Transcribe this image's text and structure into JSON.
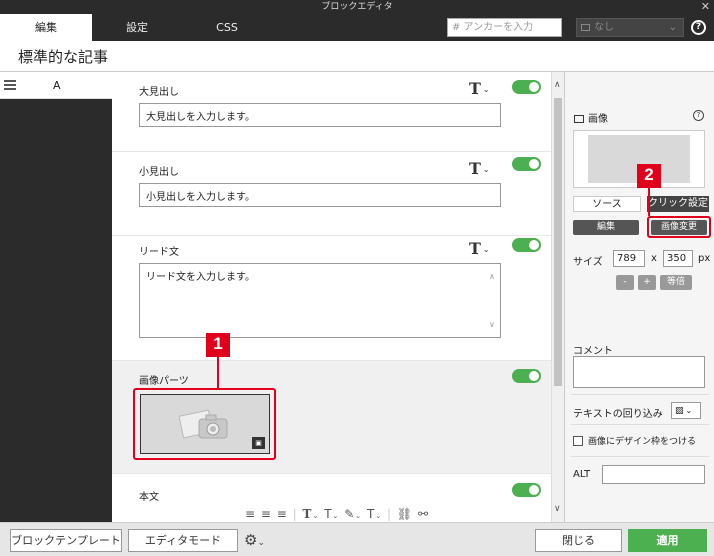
{
  "window": {
    "title": "ブロックエディタ",
    "close": "✕"
  },
  "tabs": [
    {
      "label": "編集",
      "active": true
    },
    {
      "label": "設定",
      "active": false
    },
    {
      "label": "CSS",
      "active": false
    }
  ],
  "anchor": {
    "placeholder": "# アンカーを入力"
  },
  "style_select": {
    "value": "なし",
    "icon": "image-icon"
  },
  "page_title": "標準的な記事",
  "left_column": {
    "letter": "A"
  },
  "blocks": [
    {
      "label": "大見出し",
      "field": "大見出しを入力します。",
      "enabled": true
    },
    {
      "label": "小見出し",
      "field": "小見出しを入力します。",
      "enabled": true
    },
    {
      "label": "リード文",
      "field": "リード文を入力します。",
      "enabled": true
    },
    {
      "label": "画像パーツ",
      "enabled": true
    },
    {
      "label": "本文",
      "enabled": true
    }
  ],
  "callouts": [
    "1",
    "2"
  ],
  "right_panel": {
    "title": "画像",
    "tabs": [
      "ソース",
      "クリック設定"
    ],
    "edit_button": "編集",
    "change_button": "画像変更",
    "size_label": "サイズ",
    "width": "789",
    "x": "x",
    "height": "350",
    "unit": "px",
    "minus": "-",
    "plus": "+",
    "equal_button": "等倍",
    "comment_label": "コメント",
    "wrap_label": "テキストの回り込み",
    "frame_label": "画像にデザイン枠をつける",
    "alt_label": "ALT"
  },
  "footer": {
    "block_template": "ブロックテンプレート",
    "editor_mode": "エディタモード",
    "close": "閉じる",
    "apply": "適用"
  },
  "colors": {
    "accent": "#4caf50",
    "callout": "#e0001b",
    "dark": "#2b2b2b"
  }
}
